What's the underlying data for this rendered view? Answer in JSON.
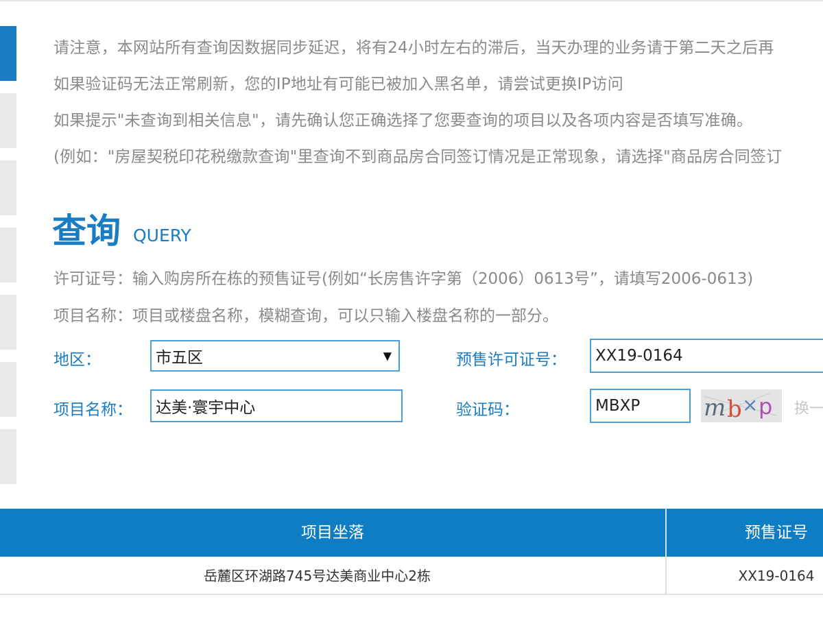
{
  "notices": [
    "请注意，本网站所有查询因数据同步延迟，将有24小时左右的滞后，当天办理的业务请于第二天之后再",
    "如果验证码无法正常刷新，您的IP地址有可能已被加入黑名单，请尝试更换IP访问",
    "如果提示\"未查询到相关信息\"，请先确认您正确选择了您要查询的项目以及各项内容是否填写准确。",
    "(例如：\"房屋契税印花税缴款查询\"里查询不到商品房合同签订情况是正常现象，请选择\"商品房合同签订"
  ],
  "query": {
    "title_cn": "查询",
    "title_en": "QUERY",
    "help": [
      "许可证号：输入购房所在栋的预售证号(例如“长房售许字第（2006）0613号”，请填写2006-0613)",
      "项目名称：项目或楼盘名称，模糊查询，可以只输入楼盘名称的一部分。"
    ]
  },
  "form": {
    "region_label": "地区：",
    "region_value": "市五区",
    "region_arrow": "▼",
    "permit_label": "预售许可证号：",
    "permit_value": "XX19-0164",
    "project_label": "项目名称：",
    "project_value": "达美·寰宇中心",
    "captcha_label": "验证码：",
    "captcha_value": "MBXP",
    "captcha_image_text": "mbxp",
    "refresh_label": "换一"
  },
  "table": {
    "headers": [
      "项目坐落",
      "预售证号"
    ],
    "rows": [
      [
        "岳麓区环湖路745号达美商业中心2栋",
        "XX19-0164"
      ]
    ]
  },
  "colors": {
    "accent": "#1a7cc3",
    "header_bg": "#0f7dc4"
  }
}
